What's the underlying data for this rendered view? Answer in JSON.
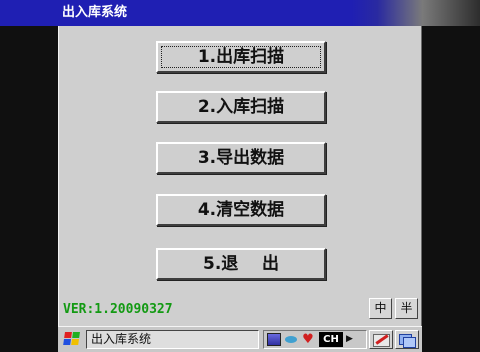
{
  "window": {
    "title": "出入库系统"
  },
  "menu": {
    "items": [
      {
        "label": "1.出库扫描"
      },
      {
        "label": "2.入库扫描"
      },
      {
        "label": "3.导出数据"
      },
      {
        "label": "4.清空数据"
      },
      {
        "label": "5.退    出"
      }
    ]
  },
  "status": {
    "version": "VER:1.20090327"
  },
  "input_method": {
    "chinese_label": "中",
    "half_width_label": "半"
  },
  "taskbar": {
    "task_label": "出入库系统",
    "language_indicator": "CH"
  },
  "colors": {
    "titlebar": "#1f1fb3",
    "client_bg": "#cfcfcf",
    "version_text": "#139a13"
  }
}
